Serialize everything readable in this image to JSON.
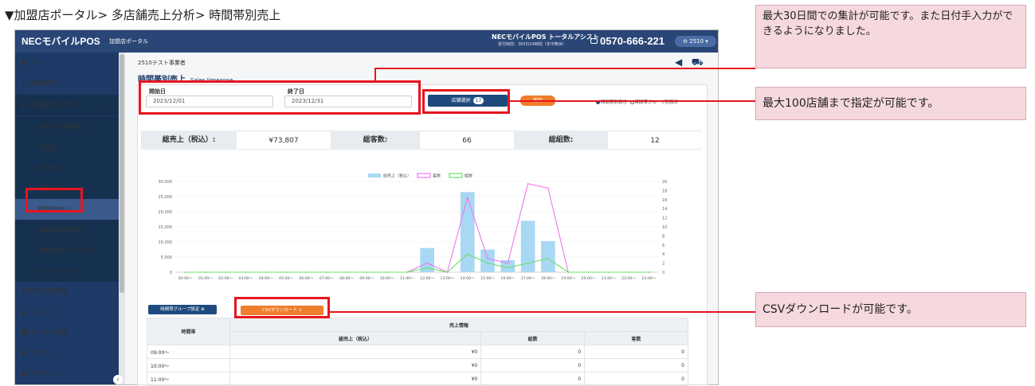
{
  "heading": "▼加盟店ポータル> 多店舗売上分析> 時間帯別売上",
  "topbar": {
    "brand": "NECモバイルPOS",
    "brand_sub": "加盟店ポータル",
    "assist": "NECモバイルPOS トータルアシスト",
    "assist_sub": "受付時間：365日24時間（年中無休）",
    "phone": "0570-666-221",
    "user": "⊖ 2510 ▾"
  },
  "sidebar": {
    "items": [
      {
        "label": "TOP",
        "icon": "dashboard-icon"
      },
      {
        "label": "実績参照",
        "icon": "list-icon",
        "chev": "‹"
      },
      {
        "label": "多店舗売上分析",
        "icon": "document-icon",
        "chev": "⌄"
      },
      {
        "label": "全店売上情報照会"
      },
      {
        "label": "日別売上"
      },
      {
        "label": "月別売上"
      },
      {
        "label": "店舗別売上"
      },
      {
        "label": "時間帯別売上"
      },
      {
        "label": "店舗別時間帯別売上"
      },
      {
        "label": "店舗別日報データ出力"
      },
      {
        "label": "ジャーナル出力"
      },
      {
        "label": "POS設定管理",
        "icon": "gear-icon",
        "chev": "‹"
      },
      {
        "label": "ニュース",
        "icon": "megaphone-icon",
        "chev": "‹"
      },
      {
        "label": "ユーザー管理",
        "icon": "users-icon",
        "chev": "‹"
      },
      {
        "label": "サポート",
        "icon": "lifebuoy-icon",
        "chev": "‹"
      },
      {
        "label": "マイページ",
        "icon": "card-icon",
        "chev": "‹"
      }
    ]
  },
  "content": {
    "shop": "2510テスト事業者",
    "title": "時間帯別売上",
    "title_en": "Sales timezone",
    "start_label": "開始日",
    "start_value": "2023/12/01",
    "end_label": "終了日",
    "end_value": "2023/12/31",
    "store_button": "店舗選択",
    "store_count": "17",
    "run_button": "実行",
    "radio1": "時間帯別表示",
    "radio2": "時間帯グループ別表示",
    "summary": {
      "sales_label": "総売上（税込）:",
      "sales_value": "¥73,807",
      "customers_label": "総客数:",
      "customers_value": "66",
      "groups_label": "総組数:",
      "groups_value": "12"
    },
    "group_button": "時間帯グループ設定 ⊕",
    "csv_button": "CSVダウンロード ⇩",
    "table": {
      "header_time": "時間帯",
      "header_info": "売上情報",
      "col_sales": "総売上（税込）",
      "col_groups": "組数",
      "col_customers": "客数",
      "rows": [
        {
          "time": "09:00〜",
          "sales": "¥0",
          "groups": "0",
          "customers": "0"
        },
        {
          "time": "10:00〜",
          "sales": "¥0",
          "groups": "0",
          "customers": "0"
        },
        {
          "time": "11:00〜",
          "sales": "¥0",
          "groups": "0",
          "customers": "0"
        }
      ]
    }
  },
  "callouts": {
    "c1": "最大30日間での集計が可能です。また日付手入力ができるようになりました。",
    "c2": "最大100店舗まで指定が可能です。",
    "c3": "CSVダウンロードが可能です。"
  },
  "colors": {
    "accent": "#e8141f",
    "navy": "#1e3a66",
    "orange": "#f07d2b",
    "bar": "#a8d8f4",
    "line_customers": "#f075f0",
    "line_groups": "#6be06b"
  },
  "chart_data": {
    "type": "bar",
    "categories": [
      "00:00〜",
      "01:00〜",
      "02:00〜",
      "03:00〜",
      "04:00〜",
      "05:00〜",
      "06:00〜",
      "07:00〜",
      "08:00〜",
      "09:00〜",
      "10:00〜",
      "11:00〜",
      "12:00〜",
      "13:00〜",
      "14:00〜",
      "15:00〜",
      "16:00〜",
      "17:00〜",
      "18:00〜",
      "19:00〜",
      "20:00〜",
      "21:00〜",
      "22:00〜",
      "23:00〜"
    ],
    "series": [
      {
        "name": "総売上（税込）",
        "type": "bar",
        "axis": "left",
        "values": [
          0,
          0,
          0,
          0,
          0,
          0,
          0,
          0,
          0,
          0,
          0,
          0,
          8000,
          0,
          26500,
          7500,
          4000,
          17000,
          10300,
          0,
          0,
          0,
          0,
          0
        ]
      },
      {
        "name": "客数",
        "type": "line",
        "axis": "right",
        "values": [
          0,
          0,
          0,
          0,
          0,
          0,
          0,
          0,
          0,
          0,
          0,
          0,
          2,
          0,
          16.5,
          3,
          2,
          19.5,
          18.5,
          0,
          0,
          0,
          0,
          0
        ]
      },
      {
        "name": "組数",
        "type": "line",
        "axis": "right",
        "values": [
          0,
          0,
          0,
          0,
          0,
          0,
          0,
          0,
          0,
          0,
          0,
          0,
          1,
          0,
          4,
          2,
          1,
          2,
          3,
          0,
          0,
          0,
          0,
          0
        ]
      }
    ],
    "ylim_left": [
      0,
      30000
    ],
    "ylim_right": [
      0,
      20
    ],
    "yticks_left": [
      "0",
      "5,000",
      "10,000",
      "15,000",
      "20,000",
      "25,000",
      "30,000"
    ],
    "yticks_right": [
      "0",
      "2",
      "4",
      "6",
      "8",
      "10",
      "12",
      "14",
      "16",
      "18",
      "20"
    ],
    "legend": "top-center",
    "grid": true
  }
}
